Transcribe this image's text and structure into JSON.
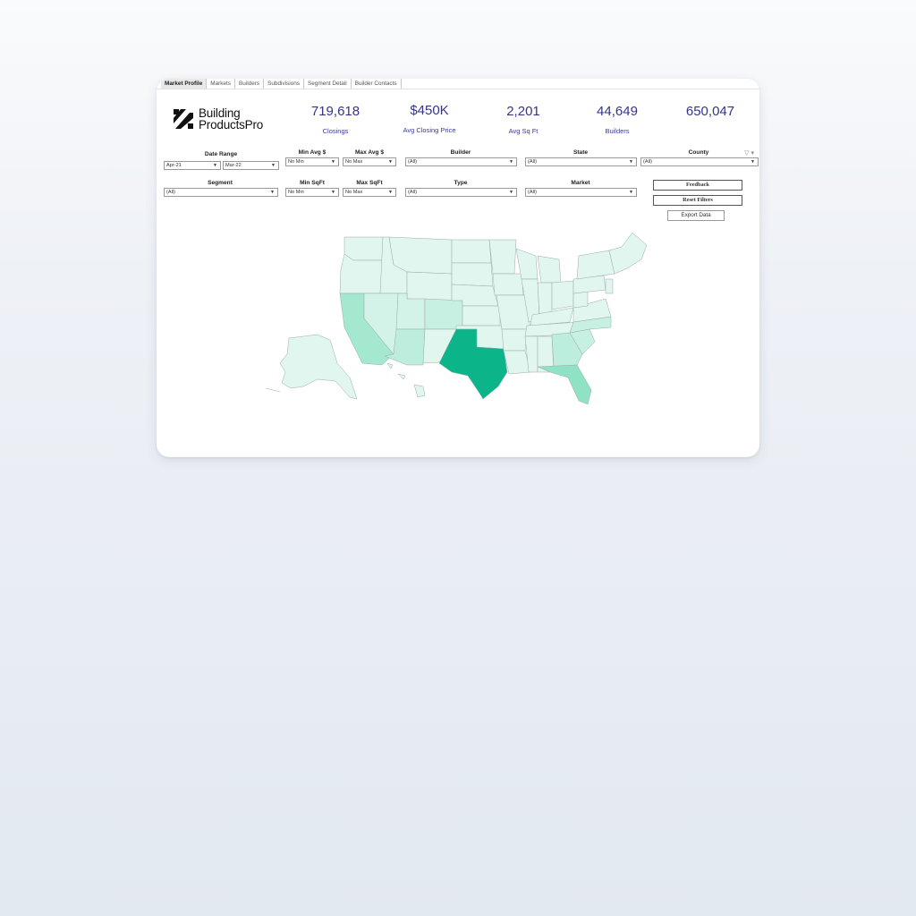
{
  "tabs": [
    "Market Profile",
    "Markets",
    "Builders",
    "Subdivisions",
    "Segment Detail",
    "Builder Contacts"
  ],
  "logo": {
    "line1": "Building",
    "line2": "ProductsPro"
  },
  "kpis": [
    {
      "value": "719,618",
      "label": "Closings"
    },
    {
      "value": "$450K",
      "label": "Avg Closing Price"
    },
    {
      "value": "2,201",
      "label": "Avg Sq Ft"
    },
    {
      "value": "44,649",
      "label": "Builders"
    },
    {
      "value": "650,047",
      "label": ""
    }
  ],
  "filters": {
    "date_range": {
      "label": "Date Range",
      "from": "Apr-21",
      "to": "Mar-22"
    },
    "min_avg": {
      "label": "Min Avg $",
      "value": "No Min"
    },
    "max_avg": {
      "label": "Max Avg $",
      "value": "No Max"
    },
    "builder": {
      "label": "Builder",
      "value": "(All)"
    },
    "state": {
      "label": "State",
      "value": "(All)"
    },
    "county": {
      "label": "County",
      "value": "(All)"
    },
    "segment": {
      "label": "Segment",
      "value": "(All)"
    },
    "min_sqft": {
      "label": "Min SqFt",
      "value": "No Min"
    },
    "max_sqft": {
      "label": "Max SqFt",
      "value": "No Max"
    },
    "type": {
      "label": "Type",
      "value": "(All)"
    },
    "market": {
      "label": "Market",
      "value": "(All)"
    }
  },
  "buttons": {
    "feedback": "Feedback",
    "reset": "Reset Filters",
    "export": "Export Data"
  },
  "icons": {
    "filter": "filter-icon",
    "dropdown": "chevron-down-icon"
  },
  "colors": {
    "kpi_text": "#35348a",
    "map_low": "#e1f6ef",
    "map_mid": "#bdeedd",
    "map_high": "#8fe2c4",
    "map_top": "#0cb48a"
  }
}
